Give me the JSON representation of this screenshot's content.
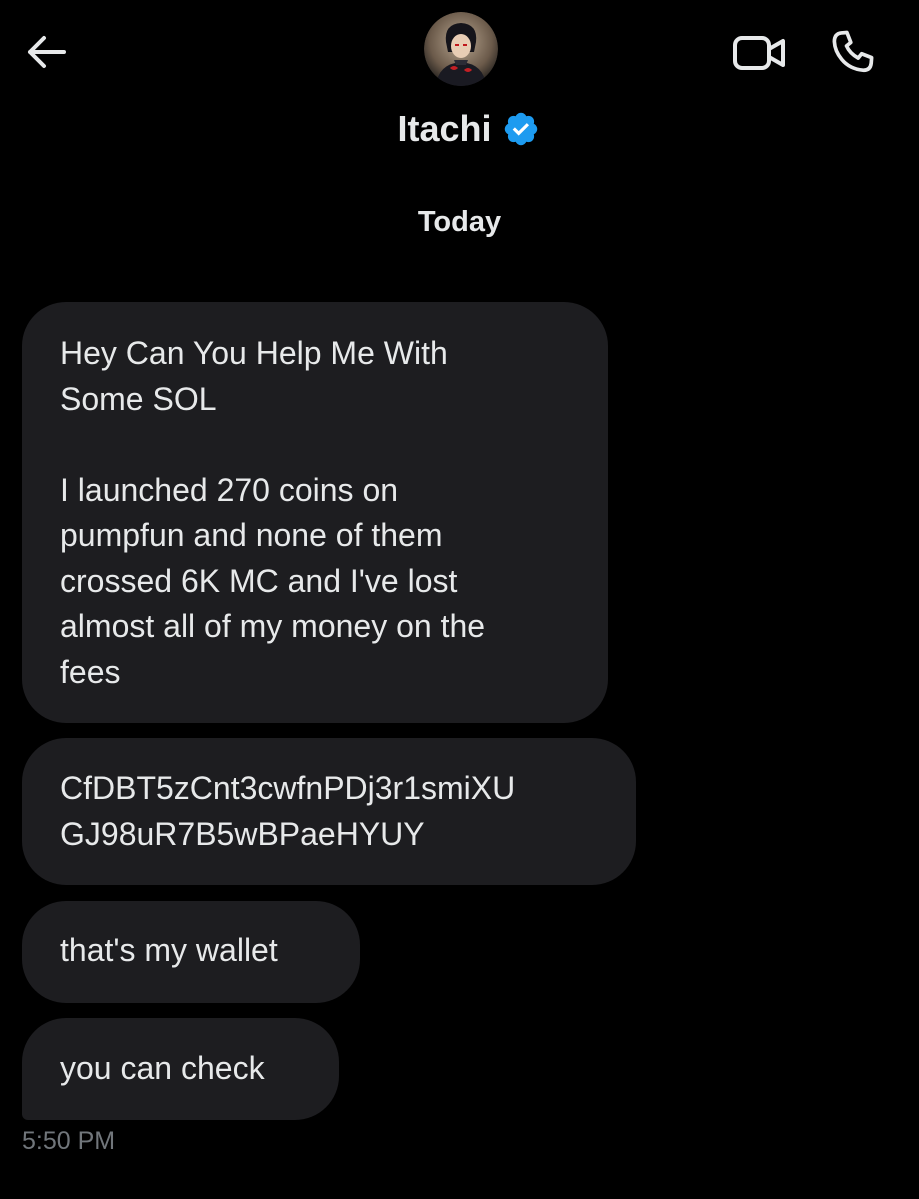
{
  "header": {
    "contact_name": "Itachi",
    "verified": true,
    "back_icon": "arrow-left-icon",
    "video_icon": "video-camera-icon",
    "call_icon": "phone-icon",
    "verified_color": "#1d9bf0"
  },
  "conversation": {
    "date_separator": "Today",
    "messages": [
      {
        "text": "Hey Can You Help Me With\nSome SOL\n\nI launched 270 coins on\npumpfun and none of them\ncrossed 6K MC and I've lost\nalmost all of my money on the\nfees"
      },
      {
        "text": "CfDBT5zCnt3cwfnPDj3r1smiXU\nGJ98uR7B5wBPaeHYUY"
      },
      {
        "text": "that's my wallet"
      },
      {
        "text": "you can check"
      }
    ],
    "last_timestamp": "5:50 PM"
  },
  "colors": {
    "background": "#000000",
    "bubble": "#1d1d20",
    "text": "#e7e9ea",
    "muted": "#71767b"
  }
}
